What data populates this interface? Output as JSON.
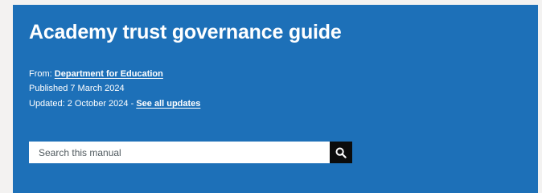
{
  "header": {
    "title": "Academy trust governance guide"
  },
  "meta": {
    "from_label": "From:",
    "from_link": "Department for Education",
    "published": "Published 7 March 2024",
    "updated_label": "Updated: 2 October 2024 -",
    "updated_link": "See all updates"
  },
  "search": {
    "placeholder": "Search this manual",
    "button_icon": "search-icon"
  },
  "colors": {
    "banner": "#1d70b8",
    "button": "#0b0c0c"
  }
}
